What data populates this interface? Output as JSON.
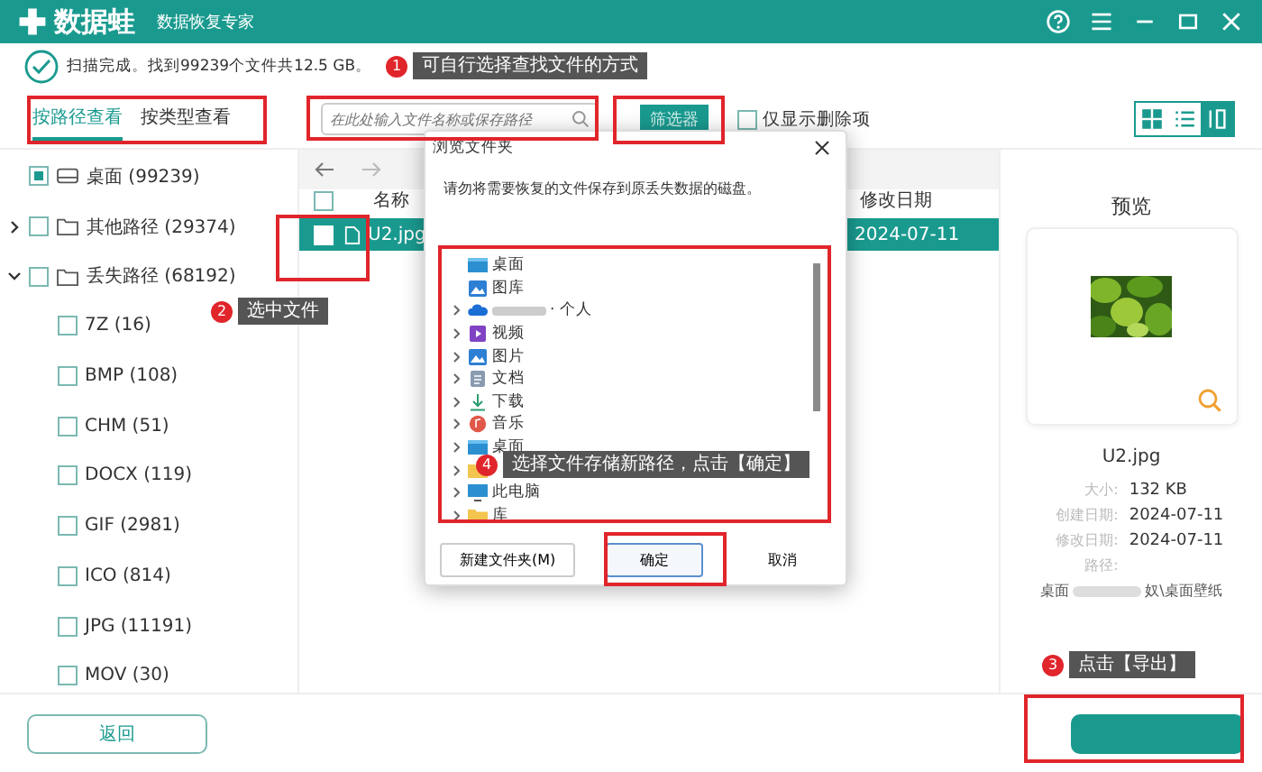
{
  "window": {
    "app_name": "数据蛙",
    "subtitle": "数据恢复专家"
  },
  "scan_status": "扫描完成。找到99239个文件共12.5 GB。",
  "view_tabs": [
    {
      "label": "按路径查看",
      "selected": true
    },
    {
      "label": "按类型查看",
      "selected": false
    }
  ],
  "search": {
    "placeholder": "在此处输入文件名称或保存路径"
  },
  "filter_button": "筛选器",
  "deleted_only": {
    "label": "仅显示删除项",
    "checked": false
  },
  "view_modes": [
    {
      "kind": "grid",
      "selected": false
    },
    {
      "kind": "list",
      "selected": false
    },
    {
      "kind": "preview",
      "selected": true
    }
  ],
  "tree": [
    {
      "label": "桌面 (99239)",
      "kind": "drive",
      "indeterminate": true
    },
    {
      "label": "其他路径 (29374)",
      "kind": "folder",
      "checked": false,
      "expanded": false
    },
    {
      "label": "丢失路径 (68192)",
      "kind": "folder",
      "checked": false,
      "expanded": true,
      "children": [
        {
          "label": "7Z (16)",
          "checked": false
        },
        {
          "label": "BMP (108)",
          "checked": false
        },
        {
          "label": "CHM (51)",
          "checked": false
        },
        {
          "label": "DOCX (119)",
          "checked": false
        },
        {
          "label": "GIF (2981)",
          "checked": false
        },
        {
          "label": "ICO (814)",
          "checked": false
        },
        {
          "label": "JPG (11191)",
          "checked": false
        },
        {
          "label": "MOV (30)",
          "checked": false
        }
      ]
    }
  ],
  "file_list": {
    "columns": [
      "名称",
      "修改日期"
    ],
    "header_checked": false,
    "rows": [
      {
        "name": "U2.jpg",
        "modified": "2024-07-11",
        "selected": true,
        "checked": false
      }
    ]
  },
  "preview": {
    "title": "预览",
    "file_name": "U2.jpg",
    "details": [
      {
        "label": "大小:",
        "value": "132 KB"
      },
      {
        "label": "创建日期:",
        "value": "2024-07-11"
      },
      {
        "label": "修改日期:",
        "value": "2024-07-11"
      },
      {
        "label": "路径:"
      }
    ],
    "path_start": "桌面",
    "path_end": "奴\\桌面壁纸"
  },
  "dialog": {
    "title": "浏览文件夹",
    "message": "请勿将需要恢复的文件保存到原丢失数据的磁盘。",
    "folders": [
      {
        "label": "桌面",
        "kind": "desktop",
        "expandable": false
      },
      {
        "label": "图库",
        "kind": "gallery",
        "expandable": false
      },
      {
        "label": "· 个人",
        "kind": "cloud",
        "expandable": true,
        "blurred": true
      },
      {
        "label": "视频",
        "kind": "video",
        "expandable": true
      },
      {
        "label": "图片",
        "kind": "gallery",
        "expandable": true
      },
      {
        "label": "文档",
        "kind": "document",
        "expandable": true
      },
      {
        "label": "下载",
        "kind": "download",
        "expandable": true
      },
      {
        "label": "音乐",
        "kind": "music",
        "expandable": true
      },
      {
        "label": "桌面",
        "kind": "desktop",
        "expandable": true
      },
      {
        "kind": "folder",
        "expandable": true
      },
      {
        "label": "此电脑",
        "kind": "pc",
        "expandable": true
      },
      {
        "label": "库",
        "kind": "folder",
        "expandable": true
      }
    ],
    "buttons": [
      {
        "label": "新建文件夹(M)",
        "default": false
      },
      {
        "label": "确定",
        "default": true
      },
      {
        "label": "取消",
        "default": false
      }
    ]
  },
  "back_button": "返回",
  "annotations": [
    {
      "number": "1",
      "text": "可自行选择查找文件的方式"
    },
    {
      "number": "2",
      "text": "选中文件"
    },
    {
      "number": "3",
      "text": "点击【导出】"
    },
    {
      "number": "4",
      "text": "选择文件存储新路径，点击【确定】"
    }
  ]
}
